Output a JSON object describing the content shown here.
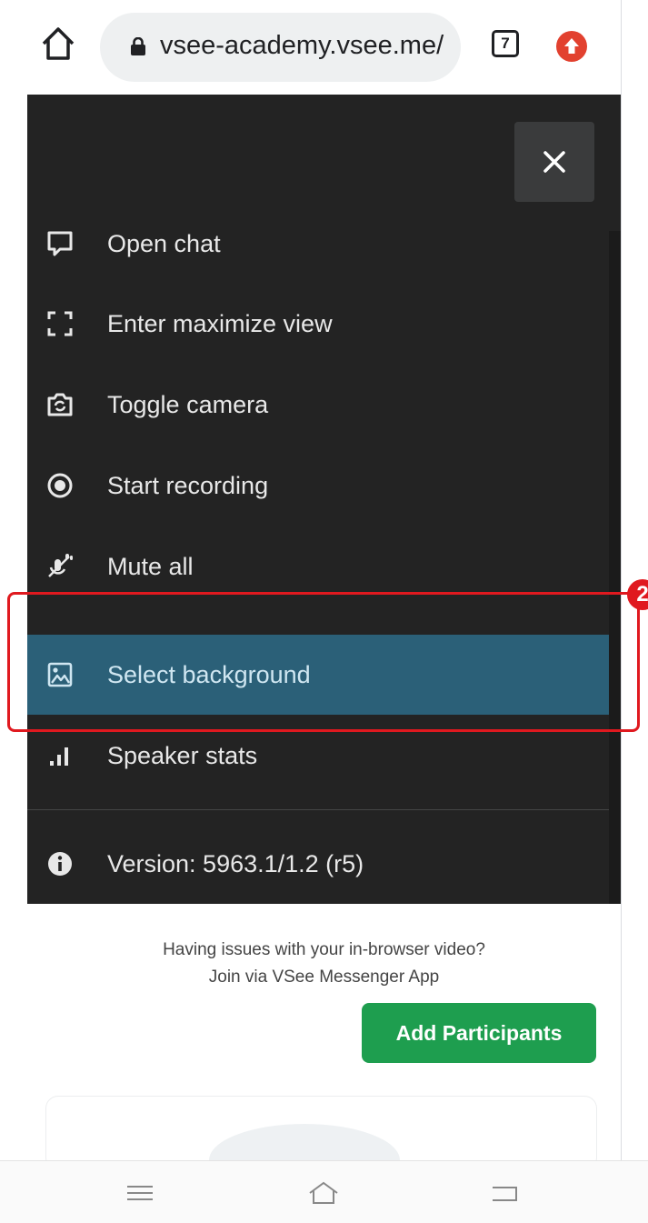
{
  "browser": {
    "url": "vsee-academy.vsee.me/",
    "tab_count": "7"
  },
  "menu": {
    "items": [
      {
        "label": "Open chat",
        "icon": "chat-icon"
      },
      {
        "label": "Enter maximize view",
        "icon": "maximize-icon"
      },
      {
        "label": "Toggle camera",
        "icon": "camera-switch-icon"
      },
      {
        "label": "Start recording",
        "icon": "record-icon"
      },
      {
        "label": "Mute all",
        "icon": "mute-all-icon"
      },
      {
        "label": "Select background",
        "icon": "image-icon",
        "selected": true
      },
      {
        "label": "Speaker stats",
        "icon": "stats-icon"
      }
    ],
    "version": "Version: 5963.1/1.2 (r5)"
  },
  "annotation": {
    "step": "2",
    "color": "#e0191f"
  },
  "page": {
    "issue_line1": "Having issues with your in-browser video?",
    "issue_line2": "Join via VSee Messenger App",
    "add_participants": "Add Participants"
  },
  "colors": {
    "menu_bg": "#232323",
    "selected_bg": "#2b6078",
    "accent_green": "#1e9e4f",
    "update_red": "#e2412f"
  }
}
